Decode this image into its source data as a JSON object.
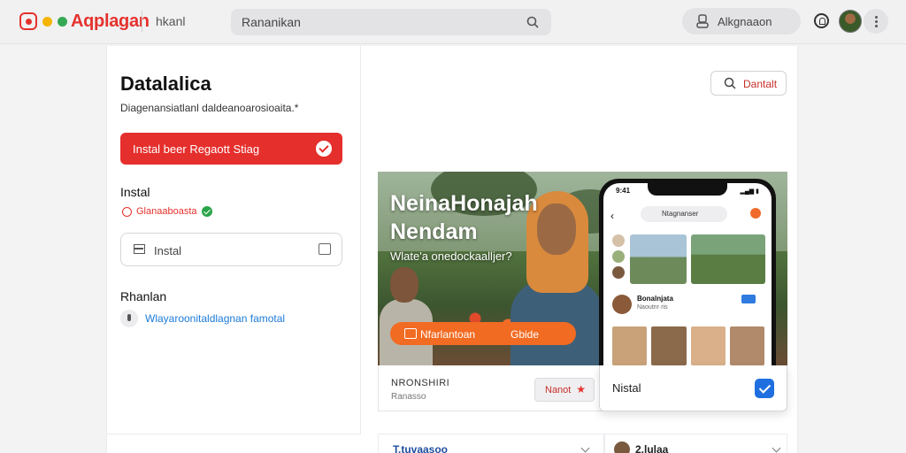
{
  "app": {
    "brand": "Aqplagan",
    "breadcrumb": "hkanl",
    "search_text": "Rananikan",
    "account_label": "Alkgnaaon"
  },
  "sidebar": {
    "title": "Datalalica",
    "subtitle": "Diagenansiatlanl daldeanoarosioaita.*",
    "cta_label": "Instal beer Regaott Stiag",
    "install": {
      "heading": "Instal",
      "status": "Glanaaboasta",
      "input_label": "Instal"
    },
    "more": {
      "heading": "Rhanlan",
      "link": "Wlayaroonitaldlagnan famotal"
    }
  },
  "main": {
    "search_button": "Dantalt",
    "hero": {
      "title": "NeinaHonajah Nendam",
      "subtitle": "Wlate'a onedockaalljer?",
      "bar_label": "Nfarlantoan",
      "bar_label_2": "Gbide",
      "phone": {
        "time": "9:41",
        "search": "Ntagnanser",
        "row_title": "Bonalnjata",
        "row_sub": "Naoutnr·ris"
      }
    },
    "card": {
      "title": "NRONSHIRI",
      "sub": "Ranasso",
      "button": "Nanot"
    },
    "popup": {
      "label": "Nistal"
    },
    "bottom": {
      "left_label": "T.tuvaasoo",
      "right_label": "2.lulaa"
    }
  },
  "colors": {
    "brand_red": "#e5322d",
    "accent_orange": "#f26b22",
    "check_blue": "#1f6fe0",
    "link_blue": "#1d7bd8",
    "success_green": "#2aa44a"
  }
}
